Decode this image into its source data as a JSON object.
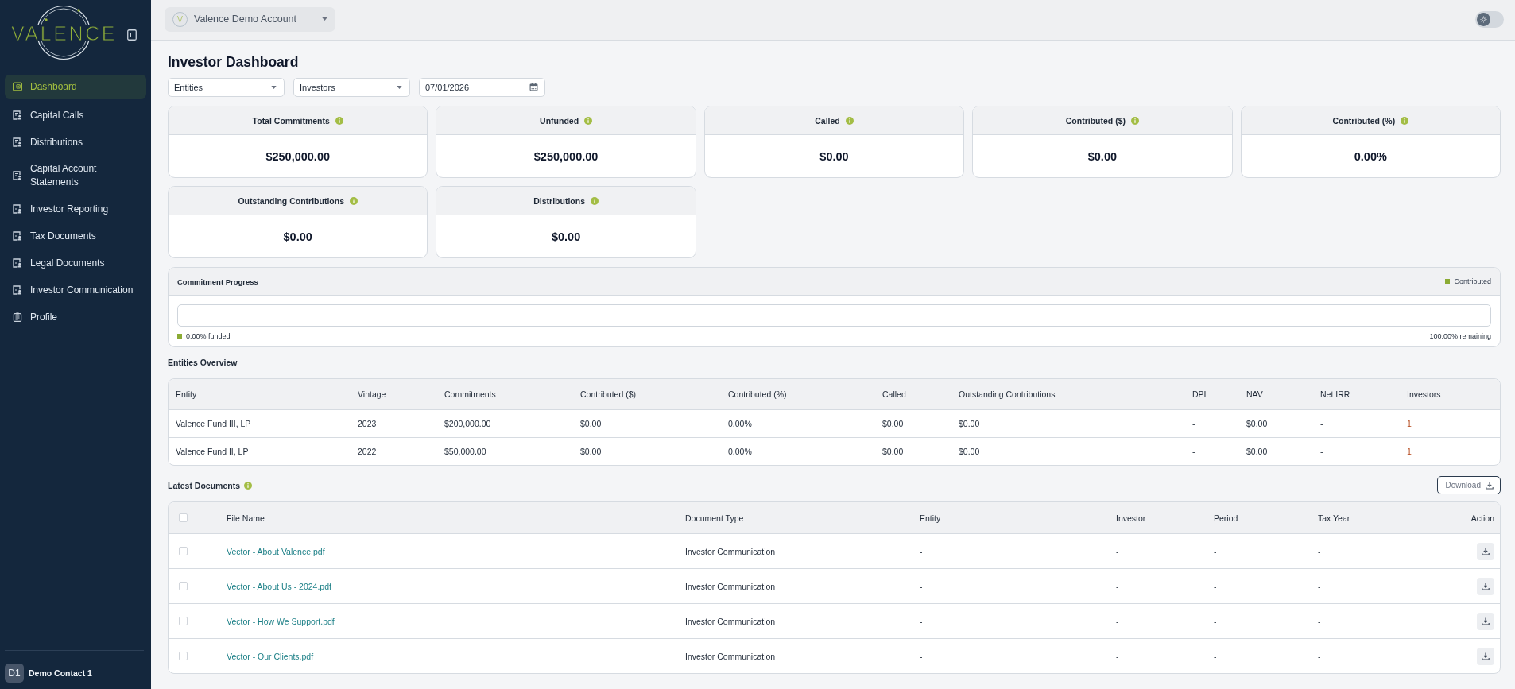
{
  "sidebar": {
    "logo": {
      "text": "VALENCE"
    },
    "items": [
      {
        "label": "Dashboard",
        "kind": "dashboard",
        "selected": true
      },
      {
        "label": "Capital Calls",
        "kind": "report",
        "selected": false
      },
      {
        "label": "Distributions",
        "kind": "report",
        "selected": false
      },
      {
        "label": "Capital Account Statements",
        "kind": "report",
        "selected": false
      },
      {
        "label": "Investor Reporting",
        "kind": "report",
        "selected": false
      },
      {
        "label": "Tax Documents",
        "kind": "report",
        "selected": false
      },
      {
        "label": "Legal Documents",
        "kind": "report",
        "selected": false
      },
      {
        "label": "Investor Communication",
        "kind": "report",
        "selected": false
      },
      {
        "label": "Profile",
        "kind": "profile",
        "selected": false
      }
    ],
    "user": {
      "initials": "D1",
      "name": "Demo Contact 1"
    }
  },
  "header": {
    "account": {
      "logo_mark": "V",
      "name": "Valence Demo Account"
    },
    "theme_toggle": {
      "on": false
    }
  },
  "page": {
    "title": "Investor Dashboard"
  },
  "filters": [
    {
      "kind": "select",
      "placeholder": "Entities"
    },
    {
      "kind": "select",
      "placeholder": "Investors"
    },
    {
      "kind": "date",
      "value": "07/01/2026"
    }
  ],
  "metrics": [
    {
      "label": "Total Commitments",
      "value": "$250,000.00"
    },
    {
      "label": "Unfunded",
      "value": "$250,000.00"
    },
    {
      "label": "Called",
      "value": "$0.00"
    },
    {
      "label": "Contributed ($)",
      "value": "$0.00"
    },
    {
      "label": "Contributed (%)",
      "value": "0.00%"
    },
    {
      "label": "Outstanding Contributions",
      "value": "$0.00"
    },
    {
      "label": "Distributions",
      "value": "$0.00"
    }
  ],
  "commitment_progress": {
    "title": "Commitment Progress",
    "legend": "Contributed",
    "level": 0,
    "funded": "0.00% funded",
    "remaining": "100.00% remaining"
  },
  "entities_overview": {
    "title": "Entities Overview",
    "columns": [
      "Entity",
      "Vintage",
      "Commitments",
      "Contributed ($)",
      "Contributed (%)",
      "Called",
      "Outstanding Contributions",
      "DPI",
      "NAV",
      "Net IRR",
      "Investors"
    ],
    "rows": [
      [
        "Valence Fund III, LP",
        "2023",
        "$200,000.00",
        "$0.00",
        "0.00%",
        "$0.00",
        "$0.00",
        "-",
        "$0.00",
        "-",
        "1"
      ],
      [
        "Valence Fund II, LP",
        "2022",
        "$50,000.00",
        "$0.00",
        "0.00%",
        "$0.00",
        "$0.00",
        "-",
        "$0.00",
        "-",
        "1"
      ]
    ]
  },
  "latest_documents": {
    "title": "Latest Documents",
    "download_button": "Download",
    "all_checked": false,
    "columns": [
      "File Name",
      "Document Type",
      "Entity",
      "Investor",
      "Period",
      "Tax Year",
      "Action"
    ],
    "rows": [
      {
        "checked": false,
        "file_name": "Vector - About Valence.pdf",
        "document_type": "Investor Communication",
        "entity": "-",
        "investor": "-",
        "period": "-",
        "tax_year": "-"
      },
      {
        "checked": false,
        "file_name": "Vector - About Us - 2024.pdf",
        "document_type": "Investor Communication",
        "entity": "-",
        "investor": "-",
        "period": "-",
        "tax_year": "-"
      },
      {
        "checked": false,
        "file_name": "Vector - How We Support.pdf",
        "document_type": "Investor Communication",
        "entity": "-",
        "investor": "-",
        "period": "-",
        "tax_year": "-"
      },
      {
        "checked": false,
        "file_name": "Vector - Our Clients.pdf",
        "document_type": "Investor Communication",
        "entity": "-",
        "investor": "-",
        "period": "-",
        "tax_year": "-"
      }
    ]
  }
}
